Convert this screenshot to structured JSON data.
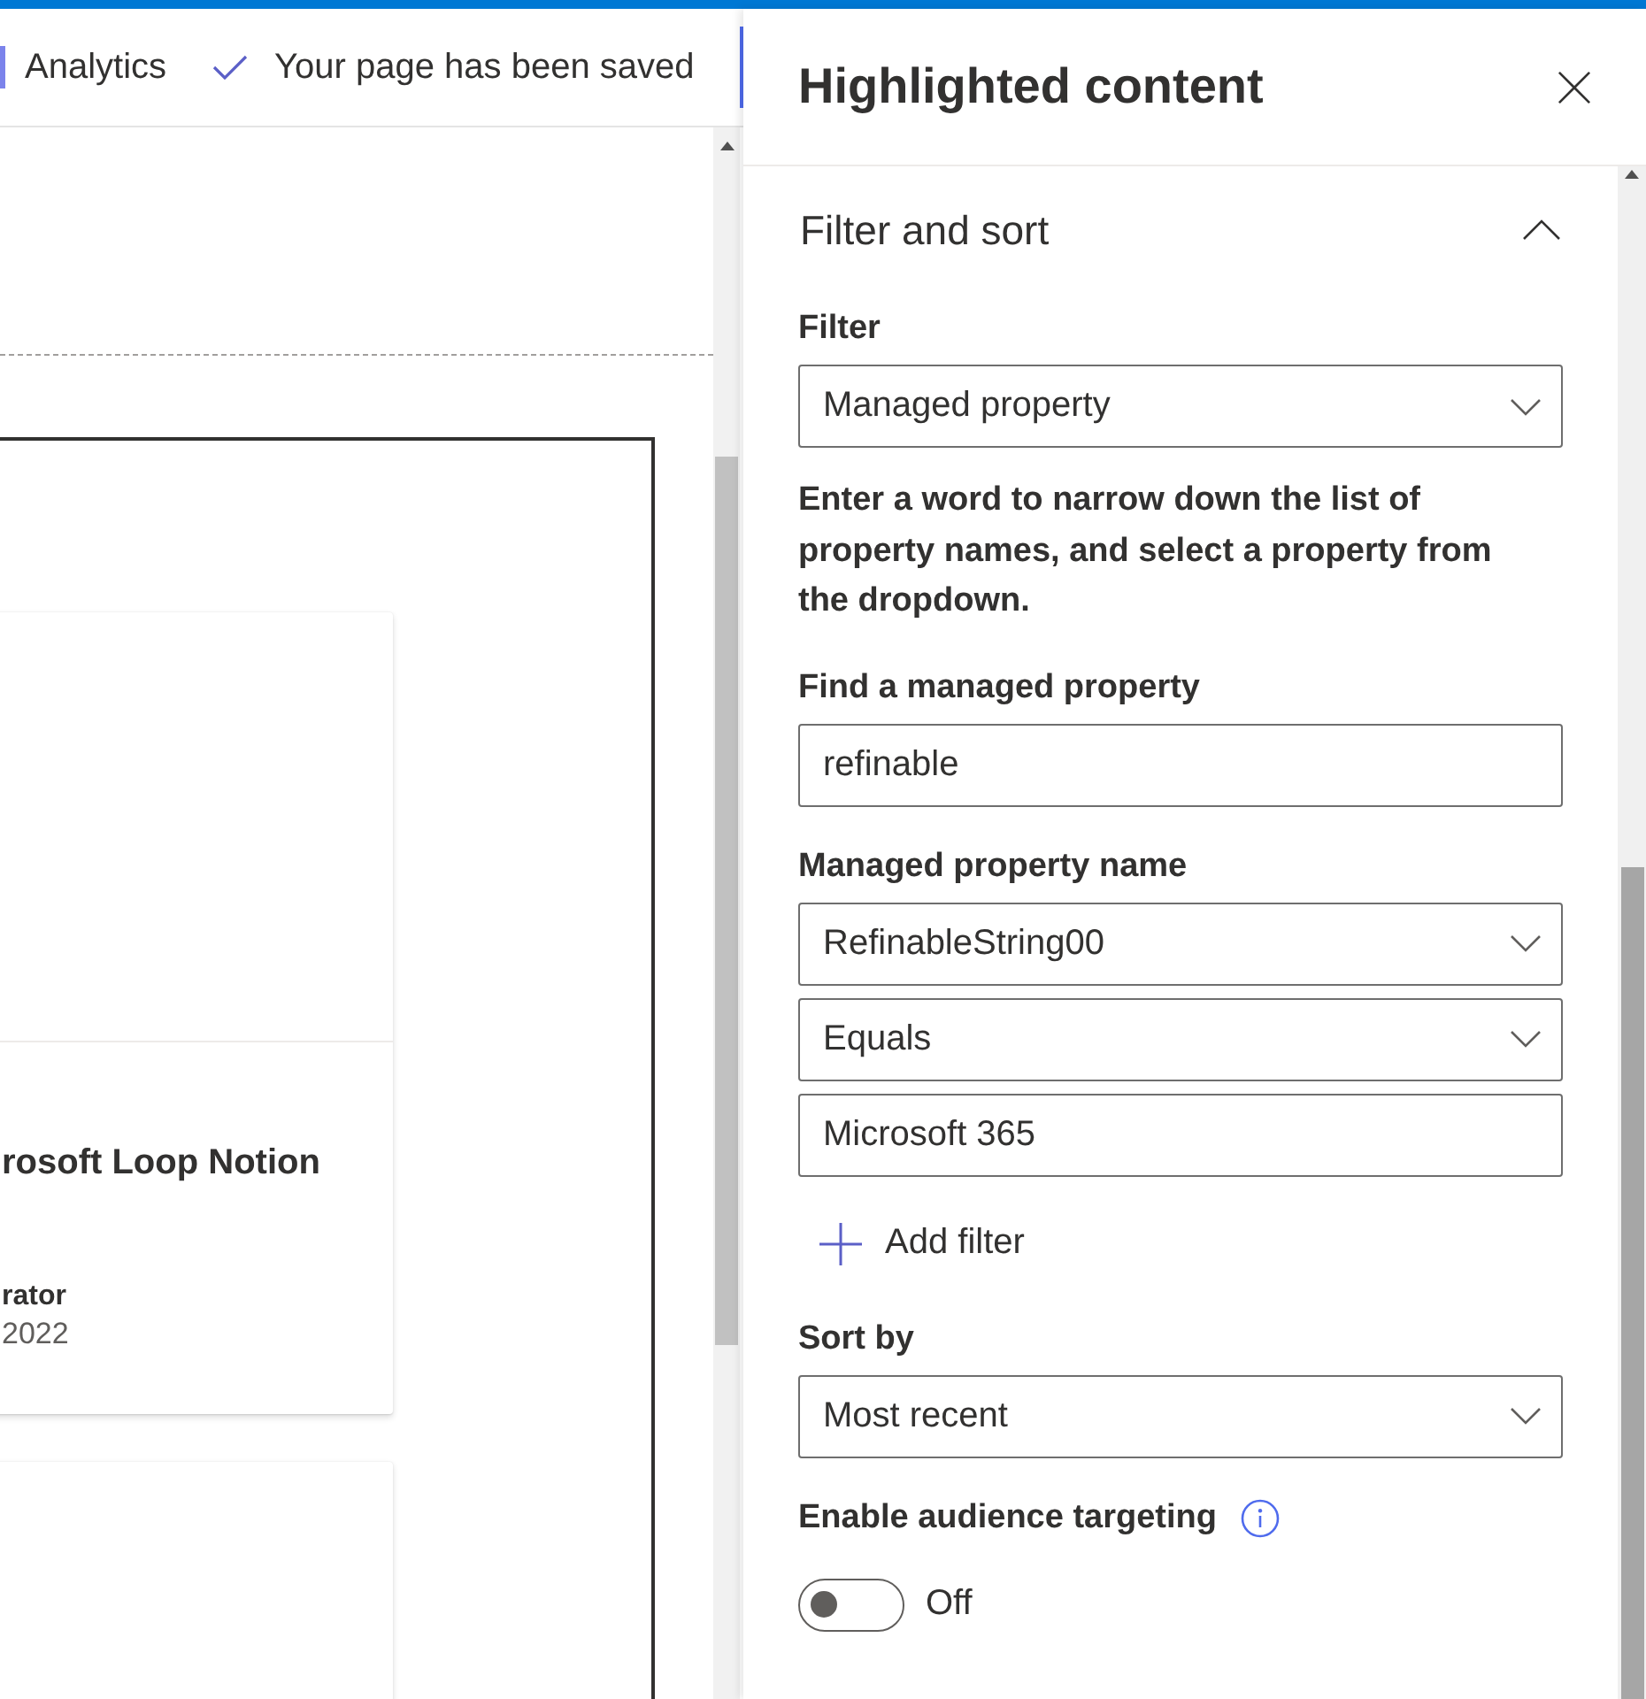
{
  "top_bar": {
    "items": [
      {
        "kind": "link",
        "label": "Analytics"
      },
      {
        "kind": "status",
        "label": "Your page has been saved"
      }
    ]
  },
  "canvas": {
    "cards": [
      {
        "kind": "news",
        "title": "rosoft Loop Notion",
        "author": "rator",
        "date": "2022"
      },
      {
        "kind": "news"
      }
    ]
  },
  "panel": {
    "title": "Highlighted content",
    "section": {
      "title": "Filter and sort",
      "expanded": true,
      "controls": [
        {
          "kind": "label",
          "text": "Filter"
        },
        {
          "kind": "dropdown",
          "value": "Managed property"
        },
        {
          "kind": "help",
          "text": "Enter a word to narrow down the list of property names, and select a property from the dropdown."
        },
        {
          "kind": "label",
          "text": "Find a managed property"
        },
        {
          "kind": "input",
          "value": "refinable"
        },
        {
          "kind": "label",
          "text": "Managed property name"
        },
        {
          "kind": "dropdown",
          "value": "RefinableString00"
        },
        {
          "kind": "dropdown",
          "value": "Equals"
        },
        {
          "kind": "input",
          "value": "Microsoft 365"
        },
        {
          "kind": "add",
          "label": "Add filter"
        },
        {
          "kind": "label",
          "text": "Sort by"
        },
        {
          "kind": "dropdown",
          "value": "Most recent"
        },
        {
          "kind": "label",
          "text": "Enable audience targeting",
          "info": true
        },
        {
          "kind": "toggle",
          "on": false,
          "label": "Off"
        }
      ]
    }
  }
}
